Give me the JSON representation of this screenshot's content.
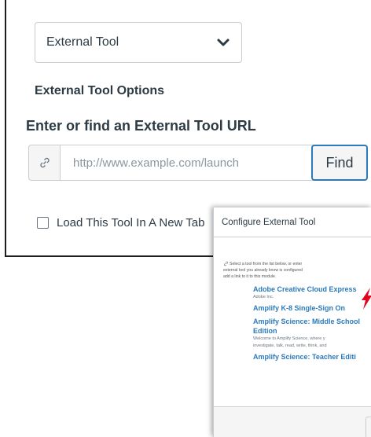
{
  "form": {
    "type_select": {
      "value": "External Tool",
      "icon": "chevron-down-icon"
    },
    "options_heading": "External Tool Options",
    "url_heading": "Enter or find an External Tool URL",
    "url_input": {
      "placeholder": "http://www.example.com/launch",
      "value": "",
      "icon": "link-icon"
    },
    "find_label": "Find",
    "new_tab_label": "Load This Tool In A New Tab",
    "new_tab_checked": false
  },
  "modal": {
    "title": "Configure External Tool",
    "intro_lines": [
      "Select a tool from the list below, or enter",
      "external tool you already know is configured",
      "add a link to it to this module."
    ],
    "tools": [
      {
        "name": "Adobe Creative Cloud Express",
        "desc": "Adobe Inc."
      },
      {
        "name": "Amplify K-8 Single-Sign On",
        "desc": ""
      },
      {
        "name": "Amplify Science: Middle School",
        "name2": "Edition",
        "desc_lines": [
          "Welcome to Amplify Science, where y",
          "investigate, talk, read, write, think, and"
        ]
      },
      {
        "name": "Amplify Science: Teacher Editi",
        "desc": ""
      }
    ],
    "highlight_color": "#e0061f"
  }
}
